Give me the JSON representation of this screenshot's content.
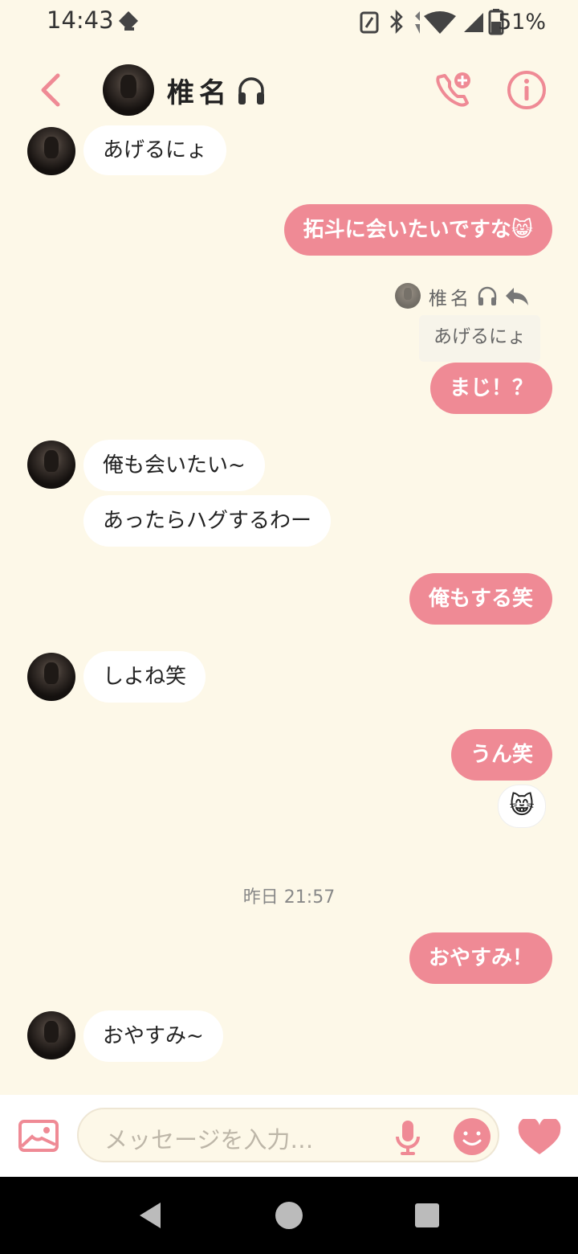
{
  "status_bar": {
    "time": "14:43",
    "battery": "51%"
  },
  "header": {
    "contact_name": "椎名"
  },
  "messages": [
    {
      "side": "in",
      "text": "あげるにょ"
    },
    {
      "side": "out",
      "text": "拓斗に会いたいですな😸"
    },
    {
      "side": "out",
      "reply_to_name": "椎名",
      "reply_to_text": "あげるにょ",
      "text": "まじ！？"
    },
    {
      "side": "in",
      "text": "俺も会いたい~"
    },
    {
      "side": "in",
      "text": "あったらハグするわー"
    },
    {
      "side": "out",
      "text": "俺もする笑"
    },
    {
      "side": "in",
      "text": "しよね笑"
    },
    {
      "side": "out",
      "text": "うん笑"
    },
    {
      "side": "out",
      "reaction": "😸"
    },
    {
      "side": "out",
      "text": "おやすみ！"
    },
    {
      "side": "in",
      "text": "おやすみ~"
    }
  ],
  "date_separator": "昨日 21:57",
  "composer": {
    "placeholder": "メッセージを入力…"
  },
  "colors": {
    "accent": "#ef8a95",
    "background": "#fdf8e8",
    "incoming_bubble": "#ffffff"
  },
  "icons": {
    "back": "chevron-left-icon",
    "headphones": "headphones-icon",
    "call": "add-call-icon",
    "info": "info-icon",
    "image": "image-icon",
    "mic": "microphone-icon",
    "sticker": "smiley-icon",
    "like": "heart-icon"
  }
}
